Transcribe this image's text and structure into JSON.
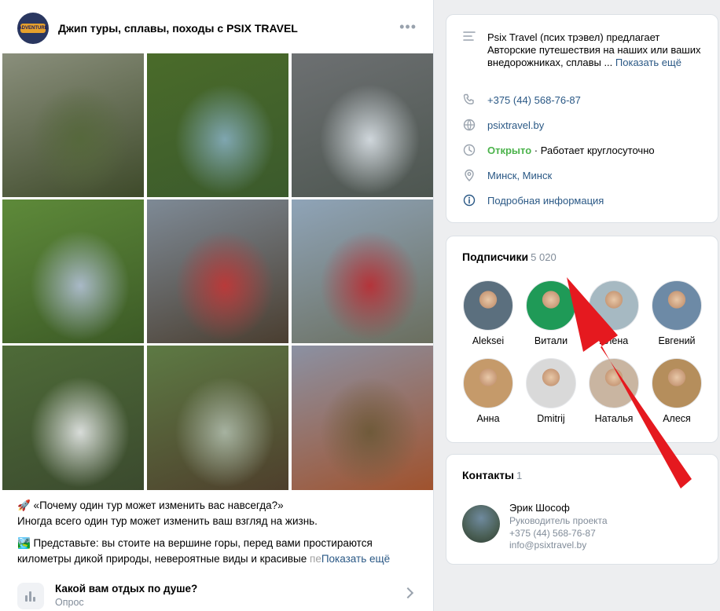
{
  "post": {
    "avatar_text": "ADVENTURE",
    "title": "Джип туры, сплавы, походы с PSIX TRAVEL",
    "more_icon": "ellipsis-icon",
    "photos": [
      {
        "name": "canyon-group-photo",
        "colors": [
          "#8a8f7c",
          "#56683c",
          "#3e4a2a"
        ]
      },
      {
        "name": "river-bathing-photo",
        "colors": [
          "#4a6b2a",
          "#7fa6b0",
          "#3b5a2c"
        ]
      },
      {
        "name": "waterfall-group-photo",
        "colors": [
          "#6d7072",
          "#cfd6db",
          "#4d5650"
        ]
      },
      {
        "name": "forest-picnic-photo",
        "colors": [
          "#5e8a3a",
          "#a9b9c7",
          "#3c5a26"
        ]
      },
      {
        "name": "rafting-team-photo",
        "colors": [
          "#7e8a96",
          "#b93a3a",
          "#4a3e30"
        ]
      },
      {
        "name": "jeep-mountain-photo",
        "colors": [
          "#8fa4b8",
          "#b4343a",
          "#6a6e5e"
        ]
      },
      {
        "name": "waterfall-crowd-photo",
        "colors": [
          "#4e6b38",
          "#d8dcd9",
          "#3b4a2e"
        ]
      },
      {
        "name": "swing-flag-photo",
        "colors": [
          "#5d7a44",
          "#a6b2a0",
          "#4e3f2c"
        ]
      },
      {
        "name": "mountain-barbecue-photo",
        "colors": [
          "#8b91a3",
          "#6f5a3a",
          "#a0522d"
        ]
      }
    ],
    "text_lines": [
      "🚀 «Почему один тур может изменить вас навсегда?»",
      "Иногда всего один тур может изменить ваш взгляд на жизнь."
    ],
    "text_line3": "🏞️ Представьте: вы стоите на вершине горы, перед вами простираются",
    "text_line4_main": "километры дикой природы, невероятные виды и красивые ",
    "text_line4_fade": "пе",
    "show_more": "Показать ещё",
    "poll": {
      "title": "Какой вам отдых по душе?",
      "subtitle": "Опрос"
    }
  },
  "info": {
    "description": "Psix Travel (псих трэвел) предлагает Авторские путешествия на наших или ваших внедорожниках, сплавы ...",
    "description_more": "Показать ещё",
    "phone": "+375 (44) 568-76-87",
    "site": "psixtravel.by",
    "status_open": "Открыто",
    "status_hours": " · Работает круглосуточно",
    "address": "Минск, Минск",
    "details": "Подробная информация"
  },
  "subscribers": {
    "title": "Подписчики",
    "count": "5 020",
    "people": [
      {
        "name": "Aleksei",
        "bg": "#5b6f7e"
      },
      {
        "name": "Витали",
        "bg": "#1f9a57"
      },
      {
        "name": "Алена",
        "bg": "#a6b9c2"
      },
      {
        "name": "Евгений",
        "bg": "#6d8aa6"
      },
      {
        "name": "Анна",
        "bg": "#c59a6a"
      },
      {
        "name": "Dmitrij",
        "bg": "#d9d9d9"
      },
      {
        "name": "Наталья",
        "bg": "#c9b5a1"
      },
      {
        "name": "Алеся",
        "bg": "#b58e5c"
      }
    ]
  },
  "contacts": {
    "title": "Контакты",
    "count": "1",
    "name": "Эрик Шософ",
    "role": "Руководитель проекта",
    "phone": "+375 (44) 568-76-87",
    "email": "info@psixtravel.by"
  },
  "annotation": {
    "color": "#e5191f"
  }
}
